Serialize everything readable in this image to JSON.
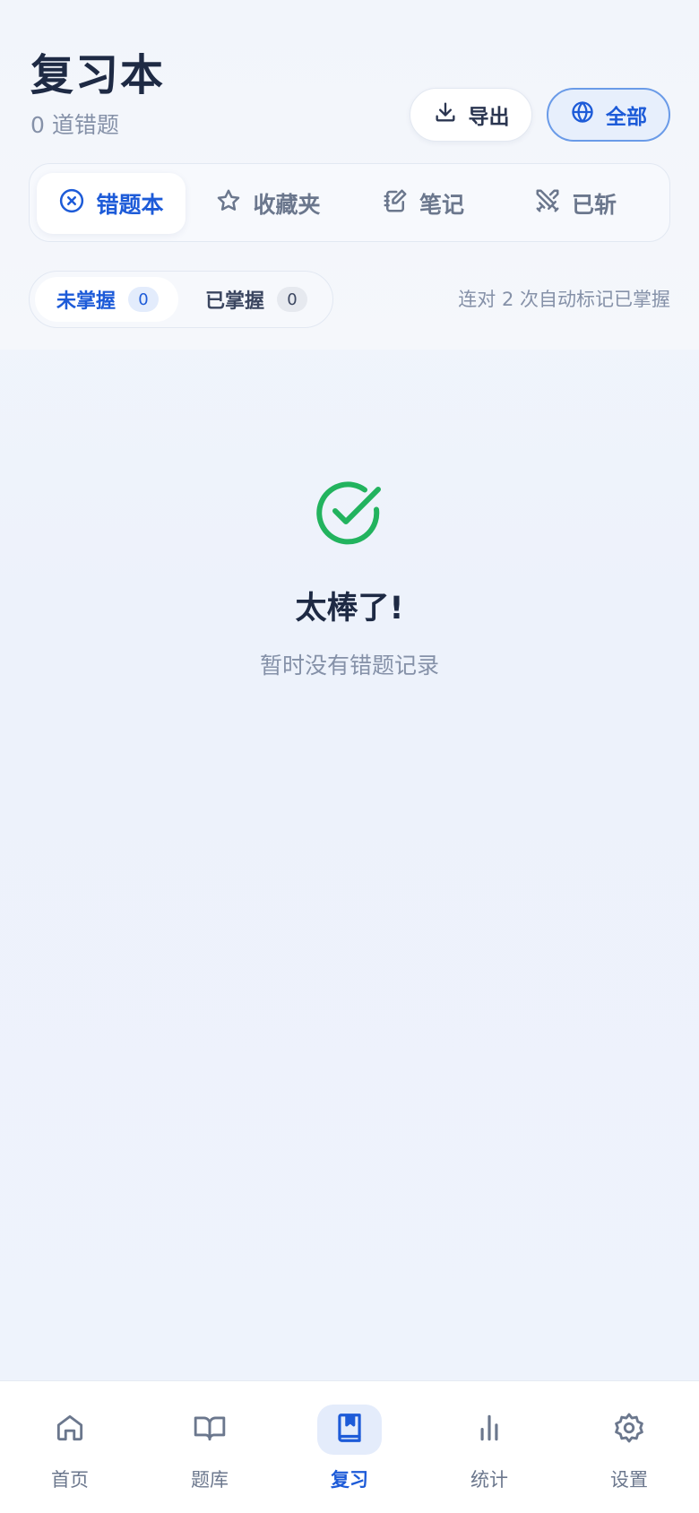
{
  "header": {
    "title": "复习本",
    "subtitle": "0 道错题",
    "export_label": "导出",
    "scope_label": "全部"
  },
  "tabs": [
    {
      "label": "错题本",
      "icon": "x-circle-icon",
      "active": true
    },
    {
      "label": "收藏夹",
      "icon": "star-icon",
      "active": false
    },
    {
      "label": "笔记",
      "icon": "note-edit-icon",
      "active": false
    },
    {
      "label": "已斩",
      "icon": "crossed-swords-icon",
      "active": false
    }
  ],
  "segments": [
    {
      "label": "未掌握",
      "count": "0",
      "active": true
    },
    {
      "label": "已掌握",
      "count": "0",
      "active": false
    }
  ],
  "hint": "连对 2 次自动标记已掌握",
  "empty_state": {
    "icon": "check-circle-icon",
    "title": "太棒了!",
    "description": "暂时没有错题记录"
  },
  "bottom_nav": [
    {
      "label": "首页",
      "icon": "home-icon",
      "active": false
    },
    {
      "label": "题库",
      "icon": "book-open-icon",
      "active": false
    },
    {
      "label": "复习",
      "icon": "bookmark-book-icon",
      "active": true
    },
    {
      "label": "统计",
      "icon": "bar-chart-icon",
      "active": false
    },
    {
      "label": "设置",
      "icon": "gear-icon",
      "active": false
    }
  ],
  "colors": {
    "accent": "#1d5bd8",
    "success": "#22b35e",
    "text_primary": "#1e2a44",
    "text_muted": "#8591a8"
  }
}
